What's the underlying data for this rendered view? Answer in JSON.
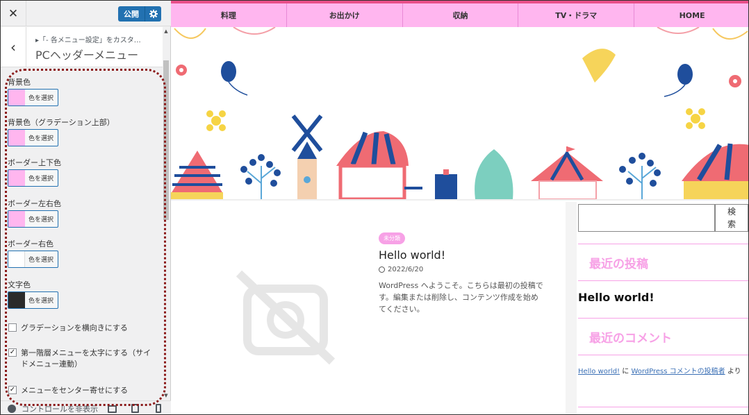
{
  "sidebar": {
    "close_glyph": "✕",
    "publish_label": "公開",
    "publish_gear_icon": "gear-icon",
    "back_glyph": "‹",
    "breadcrumb": "▸「- 各メニュー設定」をカスタ…",
    "section_title": "PCヘッダーメニュー",
    "color_button_label": "色を選択",
    "controls": [
      {
        "label": "背景色",
        "color": "#ffb6ef"
      },
      {
        "label": "背景色（グラデーション上部）",
        "color": "#ffb6ef"
      },
      {
        "label": "ボーダー上下色",
        "color": "#ffb6ef"
      },
      {
        "label": "ボーダー左右色",
        "color": "#ffb6ef"
      },
      {
        "label": "ボーダー右色",
        "color": "#ffffff"
      },
      {
        "label": "文字色",
        "color": "#2b2b2b"
      }
    ],
    "checkboxes": [
      {
        "label": "グラデーションを横向きにする",
        "checked": false
      },
      {
        "label": "第一階層メニューを太字にする（サイドメニュー連動）",
        "checked": true
      },
      {
        "label": "メニューをセンター寄せにする",
        "checked": true
      }
    ],
    "footer_label": "コントロールを非表示"
  },
  "preview": {
    "menu": [
      "料理",
      "お出かけ",
      "収納",
      "TV・ドラマ",
      "HOME"
    ],
    "post": {
      "category": "未分類",
      "title": "Hello world!",
      "date": "2022/6/20",
      "excerpt": "WordPress へようこそ。こちらは最初の投稿です。編集または削除し、コンテンツ作成を始めてください。"
    },
    "search_button": "検索",
    "widgets": {
      "recent_posts_title": "最近の投稿",
      "recent_post_item": "Hello world!",
      "recent_comments_title": "最近のコメント",
      "comment_link": "Hello world!",
      "comment_mid": " に ",
      "comment_author": "WordPress コメントの投稿者",
      "comment_tail": " より"
    }
  },
  "colors": {
    "menu_bg": "#ffb6ef",
    "menu_top_border": "#e94f8a",
    "accent_pink": "#f7a1e6",
    "publish_blue": "#2271b1",
    "highlight_border": "#8b1a1a",
    "arrow_red": "#e8161b"
  }
}
